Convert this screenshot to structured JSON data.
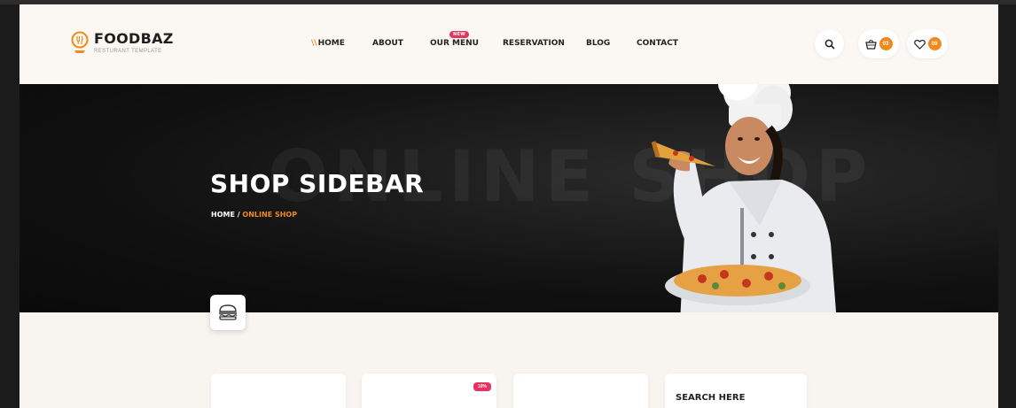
{
  "brand": {
    "name": "FOODBAZ",
    "tagline": "RESTURANT TEMPLATE"
  },
  "nav": {
    "items": [
      {
        "label": "HOME",
        "active": true
      },
      {
        "label": "ABOUT"
      },
      {
        "label": "OUR MENU",
        "badge": "NEW"
      },
      {
        "label": "RESERVATION"
      },
      {
        "label": "BLOG"
      },
      {
        "label": "CONTACT"
      }
    ]
  },
  "header": {
    "cart_count": "03",
    "wishlist_count": "09"
  },
  "hero": {
    "title": "SHOP SIDEBAR",
    "watermark": "ONLINE SHOP",
    "breadcrumb": {
      "home": "HOME",
      "separator": " / ",
      "current": "ONLINE SHOP"
    }
  },
  "products": {
    "sale_badge": "10%"
  },
  "sidebar": {
    "search_title": "SEARCH HERE"
  },
  "colors": {
    "accent": "#f08a1b",
    "badge": "#e8325e",
    "hero_bg": "#111111",
    "page_bg": "#f8f4ef"
  },
  "icons": [
    "logo-icon",
    "search-icon",
    "basket-icon",
    "heart-icon",
    "burger-icon"
  ]
}
